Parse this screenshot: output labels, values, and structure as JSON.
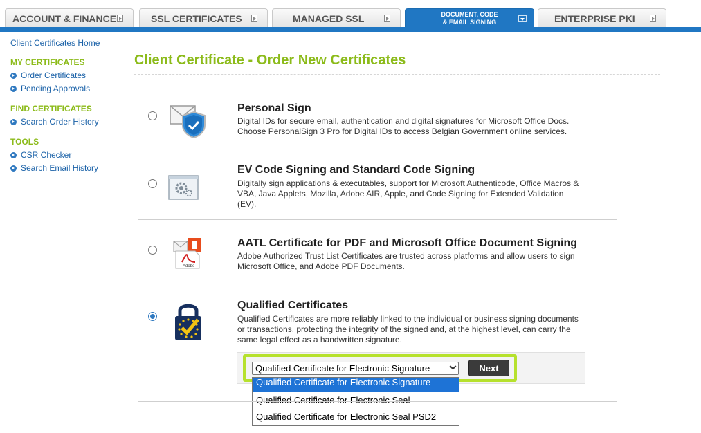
{
  "tabs": [
    {
      "label": "ACCOUNT & FINANCE"
    },
    {
      "label": "SSL CERTIFICATES"
    },
    {
      "label": "MANAGED SSL"
    },
    {
      "label_line1": "DOCUMENT, CODE",
      "label_line2": "& EMAIL SIGNING"
    },
    {
      "label": "ENTERPRISE PKI"
    }
  ],
  "sidebar": {
    "home": "Client Certificates Home",
    "groups": [
      {
        "heading": "MY CERTIFICATES",
        "items": [
          "Order Certificates",
          "Pending Approvals"
        ]
      },
      {
        "heading": "FIND CERTIFICATES",
        "items": [
          "Search Order History"
        ]
      },
      {
        "heading": "TOOLS",
        "items": [
          "CSR Checker",
          "Search Email History"
        ]
      }
    ]
  },
  "main": {
    "title": "Client Certificate - Order New Certificates",
    "options": [
      {
        "title": "Personal Sign",
        "description": "Digital IDs for secure email, authentication and digital signatures for Microsoft Office Docs. Choose PersonalSign 3 Pro for Digital IDs to access Belgian Government online services.",
        "icon": "email-shield-icon",
        "selected": false
      },
      {
        "title": "EV Code Signing and Standard Code Signing",
        "description": "Digitally sign applications & executables, support for Microsoft Authenticode, Office Macros & VBA, Java Applets, Mozilla, Adobe AIR, Apple, and Code Signing for Extended Validation (EV).",
        "icon": "code-gear-icon",
        "selected": false
      },
      {
        "title": "AATL Certificate for PDF and Microsoft Office Document Signing",
        "description": "Adobe Authorized Trust List Certificates are trusted across platforms and allow users to sign Microsoft Office, and Adobe PDF Documents.",
        "icon": "office-adobe-document-icon",
        "icon_text": "Adobe",
        "selected": false
      },
      {
        "title": "Qualified Certificates",
        "description": "Qualified Certificates are more reliably linked to the individual or business signing documents or transactions, protecting the integrity of the signed and, at the highest level, can carry the same legal effect as a handwritten signature.",
        "icon": "eu-padlock-icon",
        "selected": true
      }
    ],
    "order": {
      "selected": "Qualified Certificate for Electronic Signature",
      "options": [
        "Qualified Certificate for Electronic Signature",
        "Qualified Certificate for Electronic Seal",
        "Qualified Certificate for Electronic Seal PSD2"
      ],
      "next_label": "Next"
    }
  },
  "colors": {
    "brand_blue": "#2077c3",
    "accent_green": "#8cbb1a",
    "highlight_green": "#b6e12d",
    "link_blue": "#1b62a8"
  }
}
